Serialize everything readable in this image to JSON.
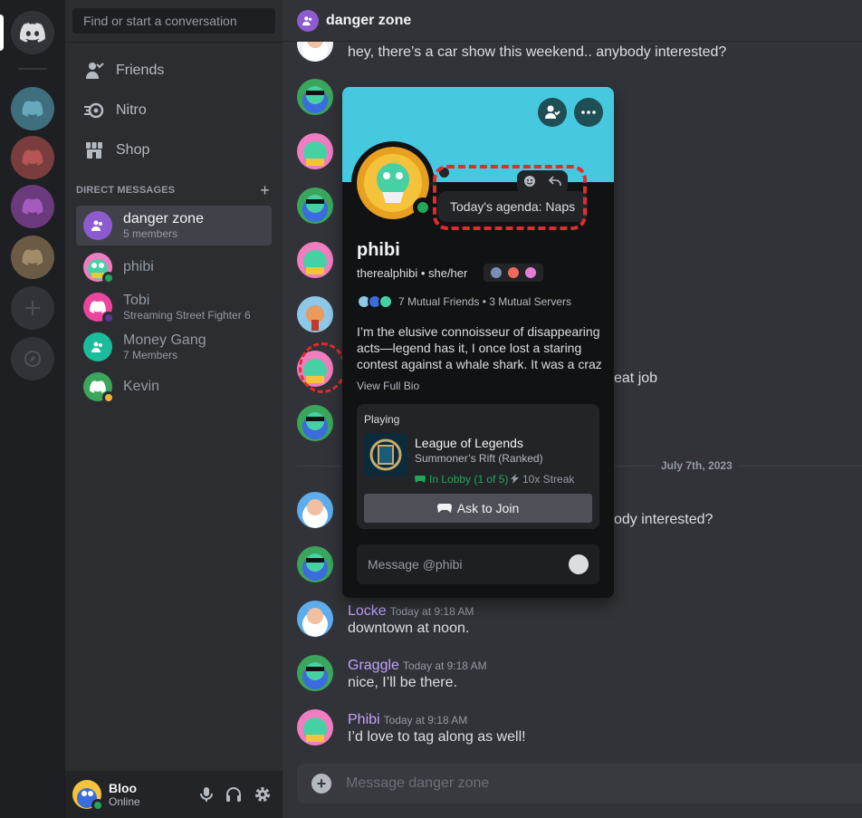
{
  "sidebar": {
    "search_placeholder": "Find or start a conversation",
    "nav": [
      {
        "label": "Friends"
      },
      {
        "label": "Nitro"
      },
      {
        "label": "Shop"
      }
    ],
    "dm_header": "DIRECT MESSAGES",
    "dms": [
      {
        "name": "danger zone",
        "sub": "5 members"
      },
      {
        "name": "phibi",
        "sub": ""
      },
      {
        "name": "Tobi",
        "sub": "Streaming Street Fighter 6"
      },
      {
        "name": "Money Gang",
        "sub": "7 Members"
      },
      {
        "name": "Kevin",
        "sub": ""
      }
    ]
  },
  "user": {
    "name": "Bloo",
    "status": "Online"
  },
  "channel": {
    "title": "danger zone"
  },
  "messages": {
    "m1": "hey, there’s a car show this weekend.. anybody interested?",
    "m2_partial": "eat job",
    "m3_partial": "ody interested?",
    "date_divider": "July 7th, 2023",
    "locke_name": "Locke",
    "locke_time": "Today at 9:18 AM",
    "locke_text": "downtown at noon.",
    "graggle_name": "Graggle",
    "graggle_time": "Today at 9:18 AM",
    "graggle_text": "nice, I’ll be there.",
    "phibi_name": "Phibi",
    "phibi_time": "Today at 9:18 AM",
    "phibi_text": "I’d love to tag along as well!"
  },
  "composer": {
    "placeholder": "Message danger zone"
  },
  "profile": {
    "custom_status": "Today's agenda: Naps",
    "name": "phibi",
    "handle": "therealphibi • she/her",
    "mutuals": "7 Mutual Friends • 3 Mutual Servers",
    "bio_lines": [
      "I’m the elusive connoisseur of disappearing",
      "acts—legend has it, I once lost a staring",
      "contest against a whale shark. It was a craz..."
    ],
    "view_bio": "View Full Bio",
    "activity": {
      "label": "Playing",
      "game": "League of Legends",
      "detail": "Summoner’s Rift (Ranked)",
      "lobby": "In Lobby (1 of 5)",
      "streak": "10x Streak",
      "join": "Ask to Join"
    },
    "message_placeholder": "Message @phibi"
  },
  "colors": {
    "accent": "#c4a2ff",
    "online": "#23a55a",
    "banner": "#46c8df",
    "highlight": "#e02c2c"
  },
  "icons": [
    "discord-logo-icon",
    "friends-icon",
    "nitro-icon",
    "shop-icon",
    "group-icon",
    "mic-icon",
    "headphones-icon",
    "gear-icon",
    "plus-icon",
    "compass-icon",
    "add-friend-icon",
    "more-icon",
    "emoji-icon",
    "reply-icon",
    "gamepad-icon",
    "lightning-icon"
  ]
}
